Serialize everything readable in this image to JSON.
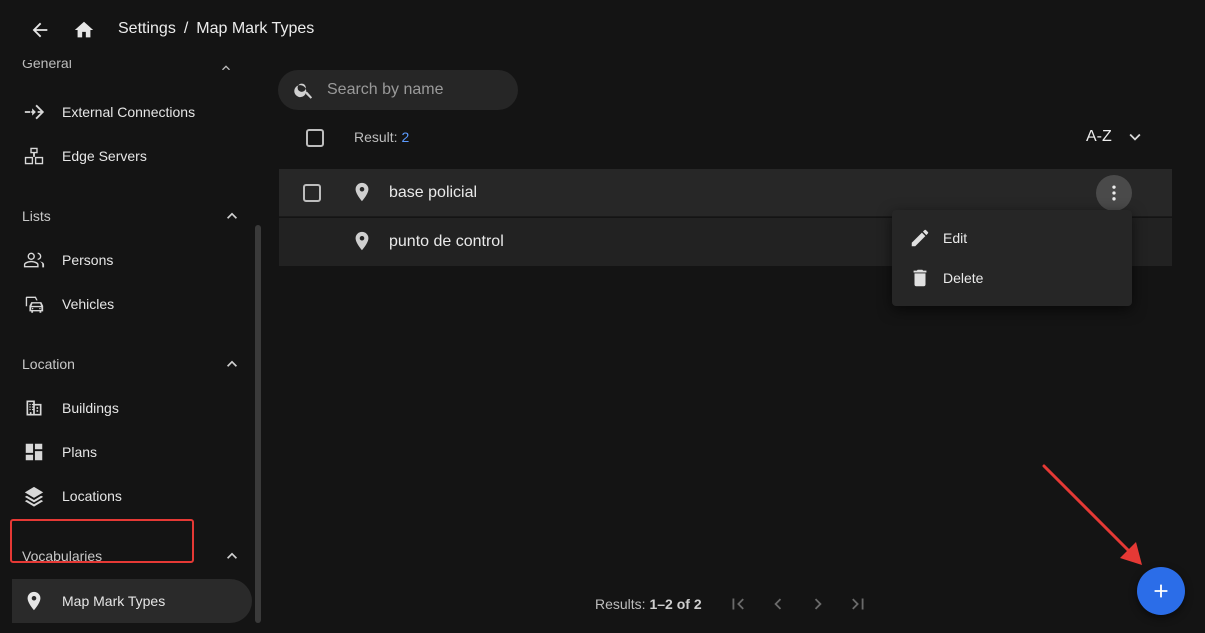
{
  "breadcrumb": {
    "parent": "Settings",
    "separator": "/",
    "current": "Map Mark Types"
  },
  "sidebar": {
    "partial_section": "General",
    "items_top": [
      {
        "label": "External Connections",
        "icon": "connection-arrow-icon"
      },
      {
        "label": "Edge Servers",
        "icon": "server-stack-icon"
      }
    ],
    "sections": [
      {
        "label": "Lists",
        "items": [
          {
            "label": "Persons",
            "icon": "people-icon"
          },
          {
            "label": "Vehicles",
            "icon": "vehicle-icon"
          }
        ]
      },
      {
        "label": "Location",
        "items": [
          {
            "label": "Buildings",
            "icon": "building-icon"
          },
          {
            "label": "Plans",
            "icon": "dashboard-icon"
          },
          {
            "label": "Locations",
            "icon": "layers-icon"
          }
        ]
      },
      {
        "label": "Vocabularies",
        "items": [
          {
            "label": "Map Mark Types",
            "icon": "location-pin-icon"
          }
        ]
      }
    ]
  },
  "search": {
    "placeholder": "Search by name",
    "value": ""
  },
  "list": {
    "result_label": "Result:",
    "result_count": "2",
    "sort_label": "A-Z",
    "rows": [
      {
        "name": "base policial"
      },
      {
        "name": "punto de control"
      }
    ]
  },
  "menu": {
    "edit_label": "Edit",
    "delete_label": "Delete"
  },
  "pager": {
    "range_prefix": "Results:",
    "range": "1–2 of 2"
  },
  "colors": {
    "accent": "#2b6de8",
    "link": "#5c9bff",
    "highlight": "#e53935"
  }
}
